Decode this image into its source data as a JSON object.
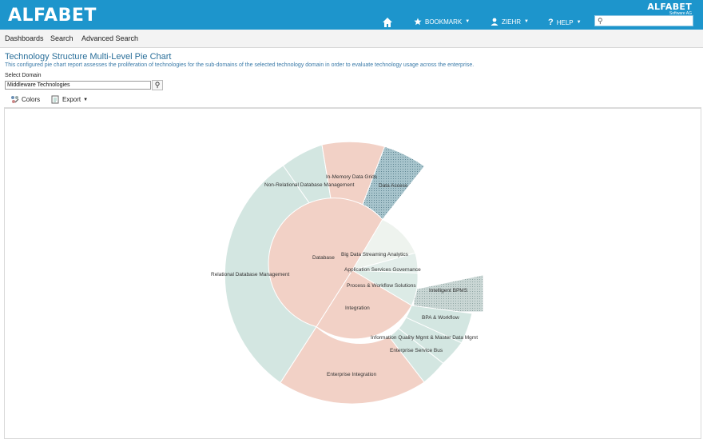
{
  "header": {
    "logo": "ALFABET",
    "brand_small": "ALFABET",
    "brand_small_sub": "Software AG",
    "nav": {
      "bookmark_label": "BOOKMARK",
      "user_label": "ZIEHR",
      "help_label": "HELP"
    },
    "search_value": ""
  },
  "menu": {
    "items": [
      "Dashboards",
      "Search",
      "Advanced Search"
    ]
  },
  "page": {
    "title": "Technology Structure Multi-Level Pie Chart",
    "subtitle": "This configured pie chart report assesses the proliferation of technologies for the sub-domains of the selected technology domain in order to evaluate technology usage across the enterprise.",
    "select_label": "Select Domain",
    "domain_value": "Middleware Technologies"
  },
  "toolbar": {
    "colors_label": "Colors",
    "export_label": "Export"
  },
  "colors": {
    "header_blue": "#1d95cc",
    "salmon": "#f2d1c6",
    "teal": "#cfe3df",
    "dark_teal": "#a9cdd2"
  },
  "chart_data": {
    "type": "pie",
    "levels": [
      {
        "level": 1,
        "segments": [
          {
            "label": "Database"
          },
          {
            "label": "Big Data Streaming Analytics"
          },
          {
            "label": "Application Services Governance"
          },
          {
            "label": "Process & Workflow Solutions"
          },
          {
            "label": "Integration"
          }
        ]
      },
      {
        "level": 2,
        "segments": [
          {
            "label": "Relational Database Management"
          },
          {
            "label": "Non-Relational Database Management"
          },
          {
            "label": "In-Memory Data Grids"
          },
          {
            "label": "Data Access"
          },
          {
            "label": "Intelligent BPMS"
          },
          {
            "label": "BPA & Workflow"
          },
          {
            "label": "Information Quality Mgmt & Master Data Mgmt"
          },
          {
            "label": "Enterprise Service Bus"
          },
          {
            "label": "Enterprise Integration"
          }
        ]
      }
    ]
  }
}
